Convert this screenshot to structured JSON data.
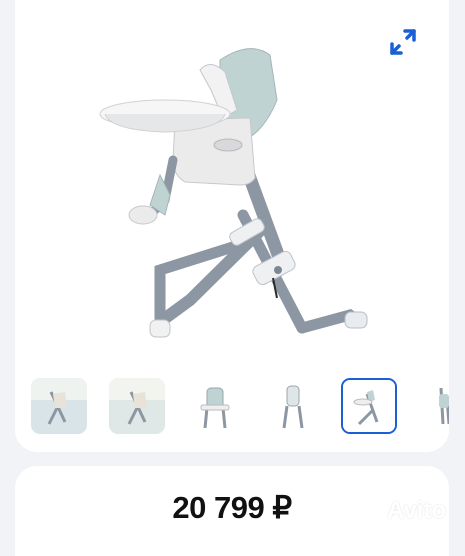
{
  "gallery": {
    "expand_icon": "expand-arrows-icon",
    "thumbnail_count": 6,
    "selected_index": 4
  },
  "listing": {
    "price": "20 799 ₽"
  },
  "watermark": {
    "text": "Avito"
  },
  "colors": {
    "accent": "#1a5fd6",
    "page_bg": "#f1f3f6",
    "chair_frame": "#8d97a3",
    "chair_seat": "#bfd3d3"
  }
}
